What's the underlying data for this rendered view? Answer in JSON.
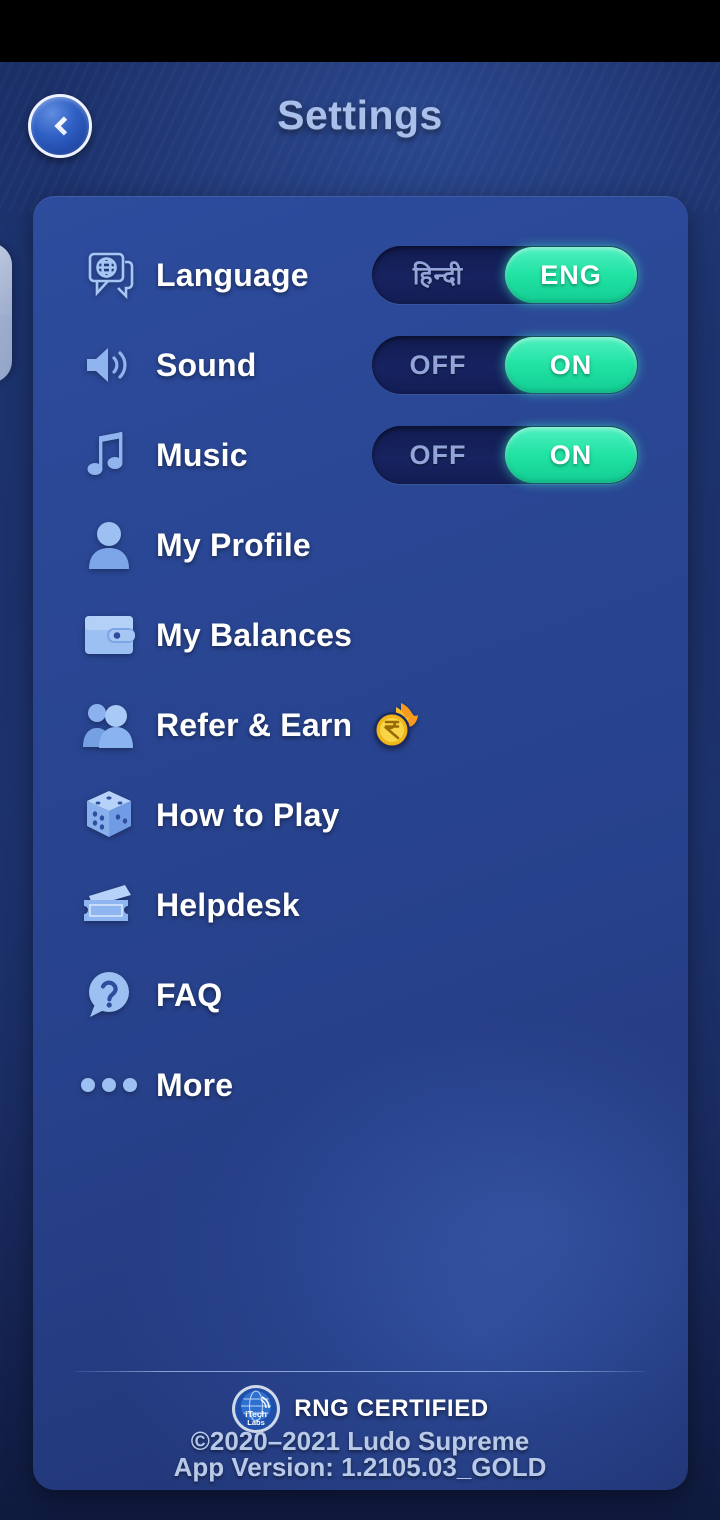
{
  "header": {
    "title": "Settings",
    "back_icon": "chevron-left-icon"
  },
  "settings_rows": [
    {
      "id": "language",
      "label": "Language",
      "icon": "globe-speech-bubble-icon",
      "toggle": {
        "left_label": "हिन्दी",
        "right_label": "ENG",
        "active": "right"
      }
    },
    {
      "id": "sound",
      "label": "Sound",
      "icon": "speaker-icon",
      "toggle": {
        "left_label": "OFF",
        "right_label": "ON",
        "active": "right"
      }
    },
    {
      "id": "music",
      "label": "Music",
      "icon": "music-note-icon",
      "toggle": {
        "left_label": "OFF",
        "right_label": "ON",
        "active": "right"
      }
    },
    {
      "id": "my-profile",
      "label": "My Profile",
      "icon": "person-icon"
    },
    {
      "id": "my-balances",
      "label": "My Balances",
      "icon": "wallet-icon"
    },
    {
      "id": "refer-earn",
      "label": "Refer & Earn",
      "icon": "two-people-icon",
      "badge_icon": "flaming-rupee-coin-icon"
    },
    {
      "id": "how-to-play",
      "label": "How to Play",
      "icon": "dice-icon"
    },
    {
      "id": "helpdesk",
      "label": "Helpdesk",
      "icon": "ticket-icon"
    },
    {
      "id": "faq",
      "label": "FAQ",
      "icon": "question-speech-bubble-icon"
    },
    {
      "id": "more",
      "label": "More",
      "icon": "three-dots-icon"
    }
  ],
  "footer": {
    "rng_logo_icon": "itech-labs-globe-icon",
    "rng_logo_line1": "iTech",
    "rng_logo_line2": "Labs",
    "rng_text": "RNG CERTIFIED",
    "copyright": "©2020–2021 Ludo Supreme",
    "app_version": "App Version: 1.2105.03_GOLD"
  },
  "colors": {
    "status_bar": "#000000",
    "background": "#1d3470",
    "panel": "#2a4795",
    "title": "#aabfe9",
    "label": "#ffffff",
    "icon": "#8fb2ec",
    "toggle_track": "#16205a",
    "toggle_active": "#22e3a5",
    "toggle_inactive_text": "#93a4d8",
    "footer_text": "#b9c9e8",
    "coin_gold": "#f5c430",
    "flame_orange": "#f58220"
  }
}
